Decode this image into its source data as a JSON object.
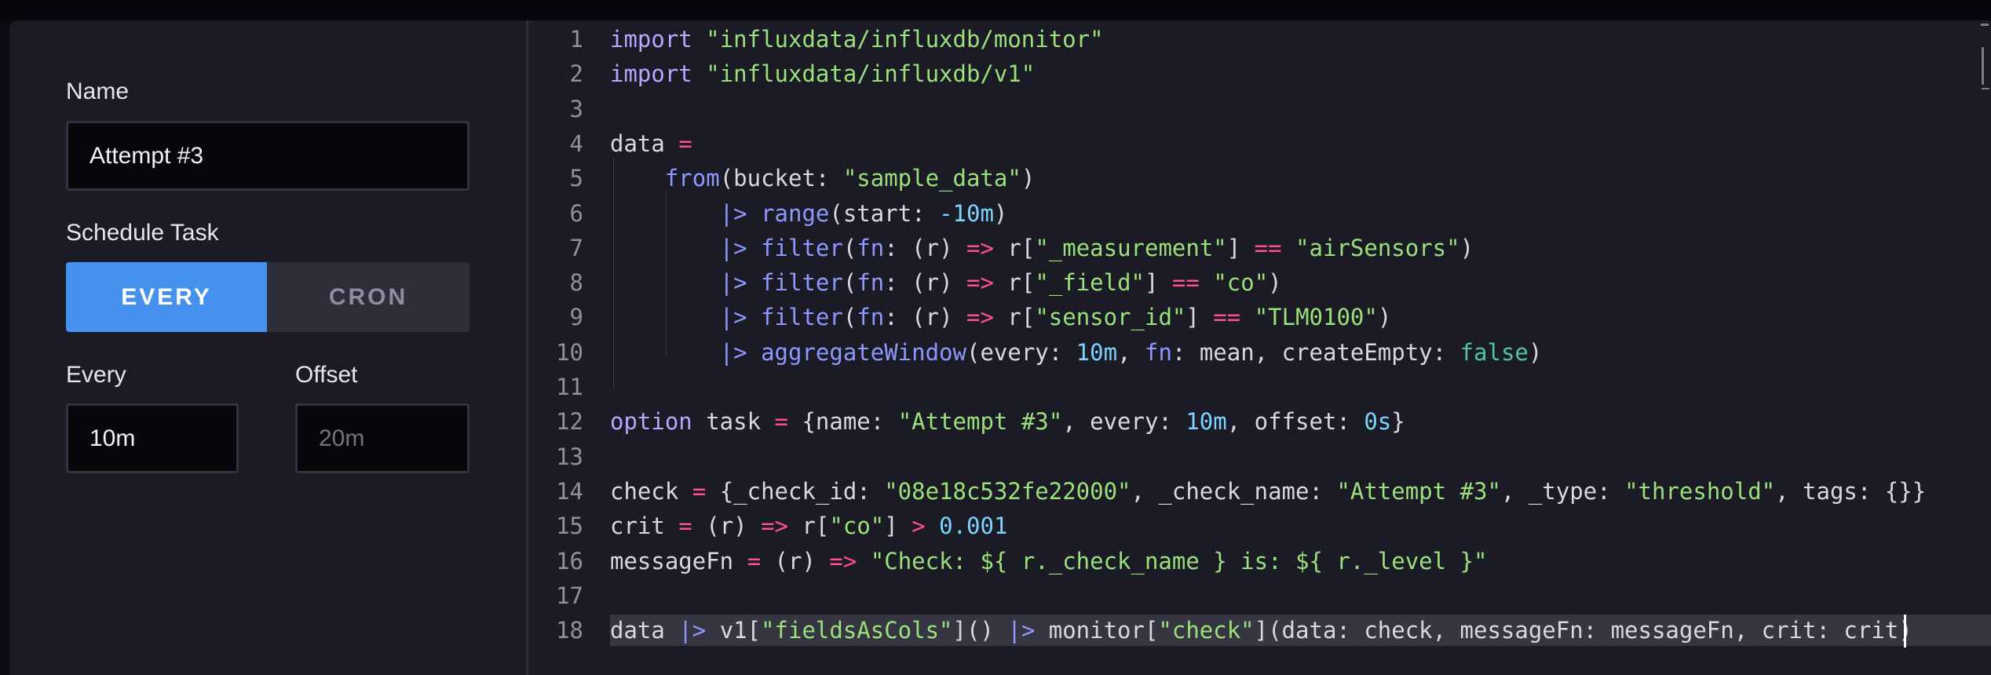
{
  "form": {
    "name_label": "Name",
    "name_value": "Attempt #3",
    "schedule_label": "Schedule Task",
    "every_option": "EVERY",
    "cron_option": "CRON",
    "every_label": "Every",
    "every_value": "10m",
    "offset_label": "Offset",
    "offset_placeholder": "20m"
  },
  "colors": {
    "accent": "#4591ed",
    "keyword": "#b7a7ff",
    "string": "#9be07a",
    "function": "#8e98ff",
    "operator": "#ff4f8f",
    "number": "#7cd4ff",
    "boolean": "#4fc49f"
  },
  "editor": {
    "lines": [
      {
        "n": "1",
        "tokens": [
          {
            "t": "import",
            "c": "kw"
          },
          {
            "t": " "
          },
          {
            "t": "\"influxdata/influxdb/monitor\"",
            "c": "str"
          }
        ]
      },
      {
        "n": "2",
        "tokens": [
          {
            "t": "import",
            "c": "kw"
          },
          {
            "t": " "
          },
          {
            "t": "\"influxdata/influxdb/v1\"",
            "c": "str"
          }
        ]
      },
      {
        "n": "3",
        "tokens": []
      },
      {
        "n": "4",
        "tokens": [
          {
            "t": "data "
          },
          {
            "t": "=",
            "c": "op"
          }
        ]
      },
      {
        "n": "5",
        "tokens": [
          {
            "t": "    "
          },
          {
            "t": "from",
            "c": "fn"
          },
          {
            "t": "(bucket: "
          },
          {
            "t": "\"sample_data\"",
            "c": "str"
          },
          {
            "t": ")"
          }
        ]
      },
      {
        "n": "6",
        "tokens": [
          {
            "t": "        "
          },
          {
            "t": "|>",
            "c": "fn"
          },
          {
            "t": " "
          },
          {
            "t": "range",
            "c": "fn"
          },
          {
            "t": "(start: "
          },
          {
            "t": "-10m",
            "c": "num"
          },
          {
            "t": ")"
          }
        ]
      },
      {
        "n": "7",
        "tokens": [
          {
            "t": "        "
          },
          {
            "t": "|>",
            "c": "fn"
          },
          {
            "t": " "
          },
          {
            "t": "filter",
            "c": "fn"
          },
          {
            "t": "("
          },
          {
            "t": "fn",
            "c": "fn"
          },
          {
            "t": ": (r) "
          },
          {
            "t": "=>",
            "c": "op"
          },
          {
            "t": " r["
          },
          {
            "t": "\"_measurement\"",
            "c": "str"
          },
          {
            "t": "] "
          },
          {
            "t": "==",
            "c": "op"
          },
          {
            "t": " "
          },
          {
            "t": "\"airSensors\"",
            "c": "str"
          },
          {
            "t": ")"
          }
        ]
      },
      {
        "n": "8",
        "tokens": [
          {
            "t": "        "
          },
          {
            "t": "|>",
            "c": "fn"
          },
          {
            "t": " "
          },
          {
            "t": "filter",
            "c": "fn"
          },
          {
            "t": "("
          },
          {
            "t": "fn",
            "c": "fn"
          },
          {
            "t": ": (r) "
          },
          {
            "t": "=>",
            "c": "op"
          },
          {
            "t": " r["
          },
          {
            "t": "\"_field\"",
            "c": "str"
          },
          {
            "t": "] "
          },
          {
            "t": "==",
            "c": "op"
          },
          {
            "t": " "
          },
          {
            "t": "\"co\"",
            "c": "str"
          },
          {
            "t": ")"
          }
        ]
      },
      {
        "n": "9",
        "tokens": [
          {
            "t": "        "
          },
          {
            "t": "|>",
            "c": "fn"
          },
          {
            "t": " "
          },
          {
            "t": "filter",
            "c": "fn"
          },
          {
            "t": "("
          },
          {
            "t": "fn",
            "c": "fn"
          },
          {
            "t": ": (r) "
          },
          {
            "t": "=>",
            "c": "op"
          },
          {
            "t": " r["
          },
          {
            "t": "\"sensor_id\"",
            "c": "str"
          },
          {
            "t": "] "
          },
          {
            "t": "==",
            "c": "op"
          },
          {
            "t": " "
          },
          {
            "t": "\"TLM0100\"",
            "c": "str"
          },
          {
            "t": ")"
          }
        ]
      },
      {
        "n": "10",
        "tokens": [
          {
            "t": "        "
          },
          {
            "t": "|>",
            "c": "fn"
          },
          {
            "t": " "
          },
          {
            "t": "aggregateWindow",
            "c": "fn"
          },
          {
            "t": "(every: "
          },
          {
            "t": "10m",
            "c": "num"
          },
          {
            "t": ", "
          },
          {
            "t": "fn",
            "c": "fn"
          },
          {
            "t": ": mean, createEmpty: "
          },
          {
            "t": "false",
            "c": "bool"
          },
          {
            "t": ")"
          }
        ]
      },
      {
        "n": "11",
        "tokens": []
      },
      {
        "n": "12",
        "tokens": [
          {
            "t": "option",
            "c": "kw"
          },
          {
            "t": " task "
          },
          {
            "t": "=",
            "c": "op"
          },
          {
            "t": " {name: "
          },
          {
            "t": "\"Attempt #3\"",
            "c": "str"
          },
          {
            "t": ", every: "
          },
          {
            "t": "10m",
            "c": "num"
          },
          {
            "t": ", offset: "
          },
          {
            "t": "0s",
            "c": "num"
          },
          {
            "t": "}"
          }
        ]
      },
      {
        "n": "13",
        "tokens": []
      },
      {
        "n": "14",
        "tokens": [
          {
            "t": "check "
          },
          {
            "t": "=",
            "c": "op"
          },
          {
            "t": " {_check_id: "
          },
          {
            "t": "\"08e18c532fe22000\"",
            "c": "str"
          },
          {
            "t": ", _check_name: "
          },
          {
            "t": "\"Attempt #3\"",
            "c": "str"
          },
          {
            "t": ", _type: "
          },
          {
            "t": "\"threshold\"",
            "c": "str"
          },
          {
            "t": ", tags: {}}"
          }
        ]
      },
      {
        "n": "15",
        "tokens": [
          {
            "t": "crit "
          },
          {
            "t": "=",
            "c": "op"
          },
          {
            "t": " (r) "
          },
          {
            "t": "=>",
            "c": "op"
          },
          {
            "t": " r["
          },
          {
            "t": "\"co\"",
            "c": "str"
          },
          {
            "t": "] "
          },
          {
            "t": ">",
            "c": "op"
          },
          {
            "t": " "
          },
          {
            "t": "0.001",
            "c": "num"
          }
        ]
      },
      {
        "n": "16",
        "tokens": [
          {
            "t": "messageFn "
          },
          {
            "t": "=",
            "c": "op"
          },
          {
            "t": " (r) "
          },
          {
            "t": "=>",
            "c": "op"
          },
          {
            "t": " "
          },
          {
            "t": "\"Check: ${ r._check_name } is: ${ r._level }\"",
            "c": "str"
          }
        ]
      },
      {
        "n": "17",
        "tokens": []
      },
      {
        "n": "18",
        "tokens": [
          {
            "t": "data "
          },
          {
            "t": "|>",
            "c": "fn"
          },
          {
            "t": " v1["
          },
          {
            "t": "\"fieldsAsCols\"",
            "c": "str"
          },
          {
            "t": "]() "
          },
          {
            "t": "|>",
            "c": "fn"
          },
          {
            "t": " monitor["
          },
          {
            "t": "\"check\"",
            "c": "str"
          },
          {
            "t": "](data: check, messageFn: messageFn, crit: crit)"
          }
        ],
        "highlight": true
      }
    ]
  }
}
